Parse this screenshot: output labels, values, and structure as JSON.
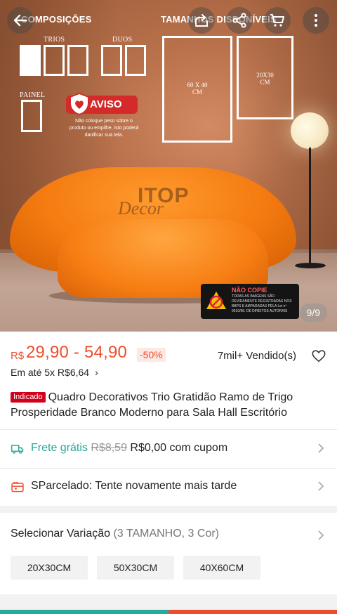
{
  "hero": {
    "left_title": "COMPOSIÇÕES",
    "right_title": "TAMANHOS DISPONÍVEIS",
    "labels": {
      "trios": "TRIOS",
      "duos": "DUOS",
      "painel": "PAINEL"
    },
    "frame_60x40": "60 X 40\nCM",
    "frame_20x30": "20X30\nCM",
    "aviso_title": "AVISO",
    "aviso_text": "Não coloque peso sobre o produto ou empilhe, isto poderá danificar sua tela.",
    "watermark": "ITOP",
    "watermark_sub": "Decor",
    "nao_copie_title": "NÃO COPIE",
    "nao_copie_text": "TODAS AS IMAGENS SÃO DEVIDAMENTE REGISTRADAS NOS BBPS E AMPARADAS PELA Lei nº 9610/98. DE DIREITOS AUTORAIS",
    "counter": "9/9"
  },
  "top_buttons": [
    "back-icon",
    "share-icon",
    "network-share-icon",
    "cart-icon",
    "more-icon"
  ],
  "product": {
    "currency": "R$",
    "price_range": "29,90 - 54,90",
    "discount": "-50%",
    "sold": "7mil+ Vendido(s)",
    "installments": "Em até 5x R$6,64",
    "tag": "Indicado",
    "title": "Quadro Decorativos Trio Gratidão Ramo de Trigo Prosperidade Branco Moderno para Sala Hall Escritório"
  },
  "shipping": {
    "free_label": "Frete grátis",
    "old_price": "R$8,59",
    "new_price": "R$0,00 com cupom"
  },
  "installment_row": {
    "text": "SParcelado: Tente novamente mais tarde"
  },
  "variation": {
    "title": "Selecionar Variação",
    "subtitle": "(3 TAMANHO, 3 Cor)",
    "options": [
      "20X30CM",
      "50X30CM",
      "40X60CM"
    ]
  },
  "colors": {
    "accent": "#ee4d2d",
    "teal": "#26aa99",
    "tag_red": "#d0011b",
    "sofa_orange": "#f47b10"
  }
}
